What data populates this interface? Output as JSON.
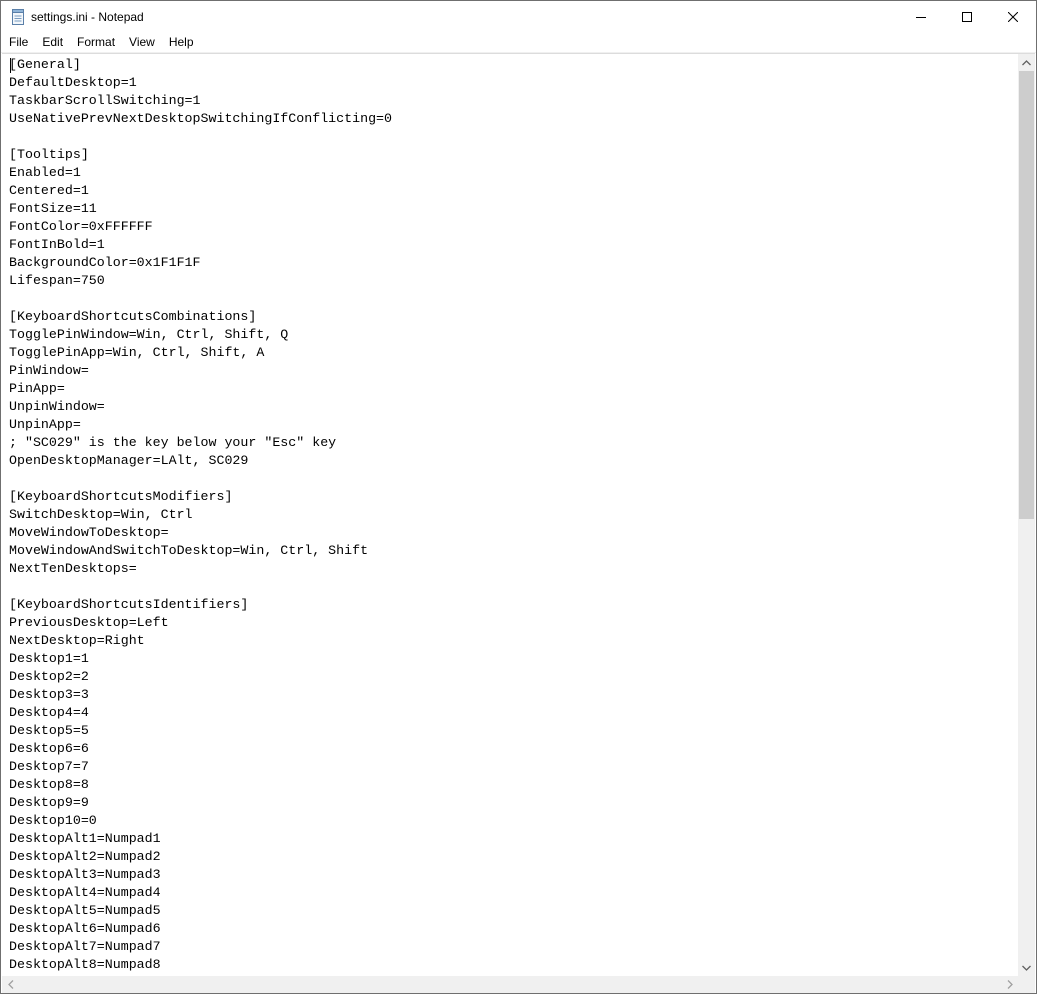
{
  "window": {
    "title": "settings.ini - Notepad"
  },
  "menu": {
    "file": "File",
    "edit": "Edit",
    "format": "Format",
    "view": "View",
    "help": "Help"
  },
  "document": {
    "text": "[General]\nDefaultDesktop=1\nTaskbarScrollSwitching=1\nUseNativePrevNextDesktopSwitchingIfConflicting=0\n\n[Tooltips]\nEnabled=1\nCentered=1\nFontSize=11\nFontColor=0xFFFFFF\nFontInBold=1\nBackgroundColor=0x1F1F1F\nLifespan=750\n\n[KeyboardShortcutsCombinations]\nTogglePinWindow=Win, Ctrl, Shift, Q\nTogglePinApp=Win, Ctrl, Shift, A\nPinWindow=\nPinApp=\nUnpinWindow=\nUnpinApp=\n; \"SC029\" is the key below your \"Esc\" key\nOpenDesktopManager=LAlt, SC029\n\n[KeyboardShortcutsModifiers]\nSwitchDesktop=Win, Ctrl\nMoveWindowToDesktop=\nMoveWindowAndSwitchToDesktop=Win, Ctrl, Shift\nNextTenDesktops=\n\n[KeyboardShortcutsIdentifiers]\nPreviousDesktop=Left\nNextDesktop=Right\nDesktop1=1\nDesktop2=2\nDesktop3=3\nDesktop4=4\nDesktop5=5\nDesktop6=6\nDesktop7=7\nDesktop8=8\nDesktop9=9\nDesktop10=0\nDesktopAlt1=Numpad1\nDesktopAlt2=Numpad2\nDesktopAlt3=Numpad3\nDesktopAlt4=Numpad4\nDesktopAlt5=Numpad5\nDesktopAlt6=Numpad6\nDesktopAlt7=Numpad7\nDesktopAlt8=Numpad8"
  },
  "icons": {
    "app": "notepad-icon",
    "minimize": "minimize-icon",
    "maximize": "maximize-icon",
    "close": "close-icon",
    "scroll_up": "chevron-up-icon",
    "scroll_down": "chevron-down-icon",
    "scroll_left": "chevron-left-icon",
    "scroll_right": "chevron-right-icon"
  },
  "colors": {
    "scroll_track": "#f0f0f0",
    "scroll_thumb": "#cdcdcd",
    "window_border": "#6f6f6f"
  }
}
